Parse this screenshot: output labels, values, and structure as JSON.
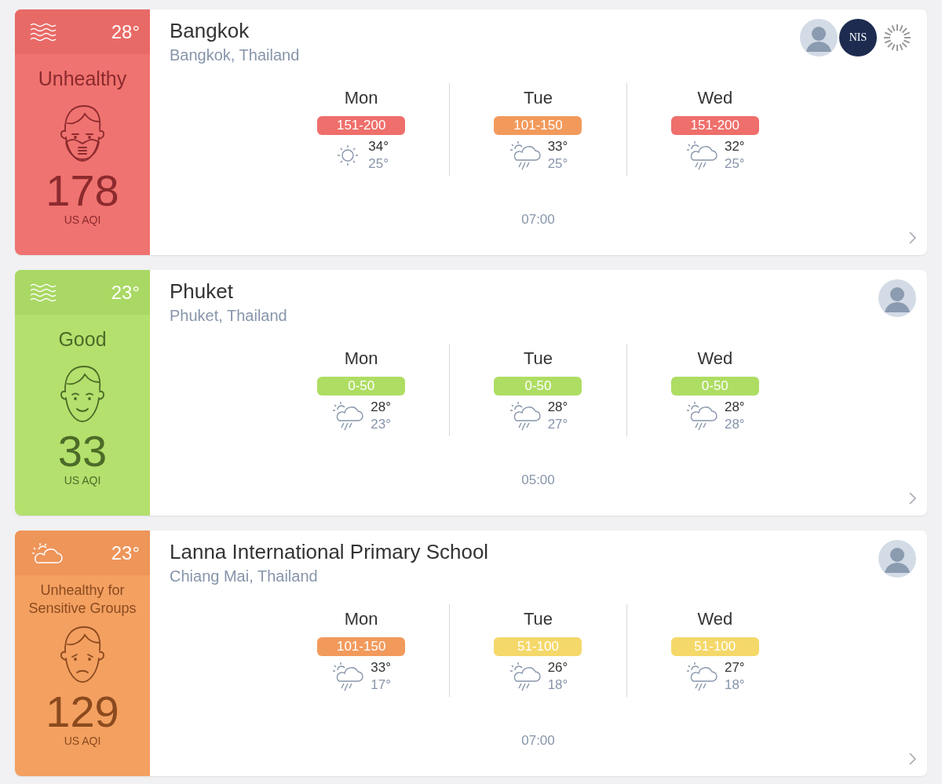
{
  "stations": [
    {
      "category": {
        "kind": "unhealthy",
        "label": "Unhealthy"
      },
      "weather": {
        "kind": "wind"
      },
      "temperature": "28°",
      "aqi": "178",
      "aqi_unit": "US AQI",
      "name": "Bangkok",
      "location": "Bangkok, Thailand",
      "avatars": [
        {
          "kind": "person"
        },
        {
          "kind": "logo",
          "text": "NIS"
        },
        {
          "kind": "loading"
        }
      ],
      "forecast": [
        {
          "day": "Mon",
          "range": "151-200",
          "color": "#ee6f6b",
          "kind": "sunny",
          "high": "34°",
          "low": "25°"
        },
        {
          "day": "Tue",
          "range": "101-150",
          "color": "#f29a5c",
          "kind": "rain",
          "high": "33°",
          "low": "25°"
        },
        {
          "day": "Wed",
          "range": "151-200",
          "color": "#ee6f6b",
          "kind": "rain",
          "high": "32°",
          "low": "25°"
        }
      ],
      "updated": "07:00"
    },
    {
      "category": {
        "kind": "good",
        "label": "Good"
      },
      "weather": {
        "kind": "wind"
      },
      "temperature": "23°",
      "aqi": "33",
      "aqi_unit": "US AQI",
      "name": "Phuket",
      "location": "Phuket, Thailand",
      "avatars": [
        {
          "kind": "person"
        }
      ],
      "forecast": [
        {
          "day": "Mon",
          "range": "0-50",
          "color": "#aedd63",
          "kind": "rain",
          "high": "28°",
          "low": "23°"
        },
        {
          "day": "Tue",
          "range": "0-50",
          "color": "#aedd63",
          "kind": "rain",
          "high": "28°",
          "low": "27°"
        },
        {
          "day": "Wed",
          "range": "0-50",
          "color": "#aedd63",
          "kind": "rain",
          "high": "28°",
          "low": "28°"
        }
      ],
      "updated": "05:00"
    },
    {
      "category": {
        "kind": "sensitive",
        "label": "Unhealthy for Sensitive Groups"
      },
      "weather": {
        "kind": "partly-cloudy"
      },
      "temperature": "23°",
      "aqi": "129",
      "aqi_unit": "US AQI",
      "name": "Lanna International Primary School",
      "location": "Chiang Mai, Thailand",
      "avatars": [
        {
          "kind": "person"
        }
      ],
      "forecast": [
        {
          "day": "Mon",
          "range": "101-150",
          "color": "#f29a5c",
          "kind": "rain",
          "high": "33°",
          "low": "17°"
        },
        {
          "day": "Tue",
          "range": "51-100",
          "color": "#f5d86a",
          "kind": "rain",
          "high": "26°",
          "low": "18°"
        },
        {
          "day": "Wed",
          "range": "51-100",
          "color": "#f5d86a",
          "kind": "rain",
          "high": "27°",
          "low": "18°"
        }
      ],
      "updated": "07:00"
    }
  ]
}
